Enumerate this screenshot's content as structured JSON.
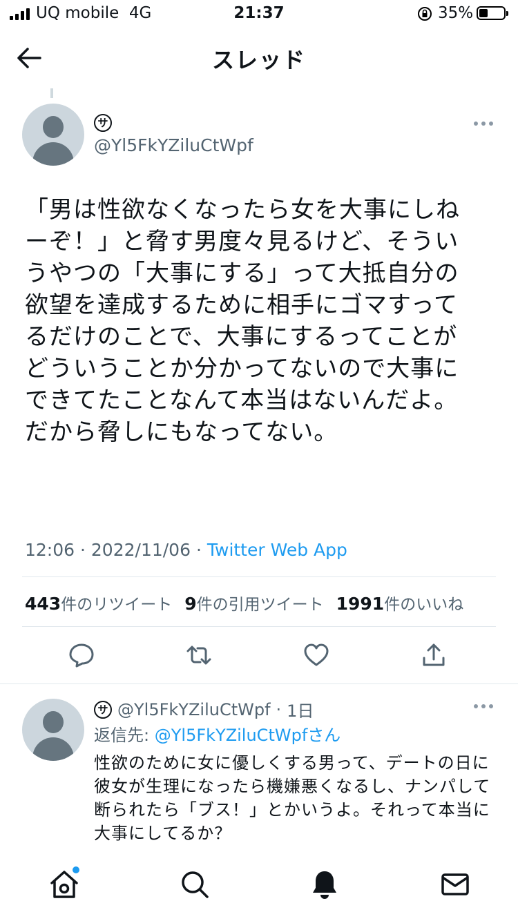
{
  "status_bar": {
    "carrier": "UQ mobile",
    "network": "4G",
    "time": "21:37",
    "battery_percent": "35%",
    "battery_level": 0.35
  },
  "header": {
    "title": "スレッド",
    "back_icon": "back-arrow-icon"
  },
  "tweet": {
    "display_name": "ⓢ",
    "handle": "@Yl5FkYZiluCtWpf",
    "text_lines": [
      "「男は性欲なくなったら女を大事にしね",
      "ーぞ！」と脅す男度々見るけど、そうい",
      "うやつの「大事にする」って大抵自分の",
      "欲望を達成するために相手にゴマすって",
      "るだけのことで、大事にするってことが",
      "どういうことか分かってないので大事に",
      "できてたことなんて本当はないんだよ。",
      "だから脅しにもなってない。"
    ],
    "time": "12:06",
    "date": "2022/11/06",
    "separator": "·",
    "source": "Twitter Web App",
    "stats": {
      "retweets_count": "443",
      "retweets_label": "件のリツイート",
      "quotes_count": "9",
      "quotes_label": "件の引用ツイート",
      "likes_count": "1991",
      "likes_label": "件のいいね"
    }
  },
  "reply": {
    "display_name": "ⓢ",
    "handle": "@Yl5FkYZiluCtWpf",
    "age": "1日",
    "reply_to_label": "返信先:",
    "reply_to_handle": "@Yl5FkYZiluCtWpf",
    "reply_to_suffix": "さん",
    "text_lines": [
      "性欲のために女に優しくする男って、デートの日に",
      "彼女が生理になったら機嫌悪くなるし、ナンパして",
      "断られたら「ブス！」とかいうよ。それって本当に",
      "大事にしてるか？"
    ]
  },
  "tab_bar": {
    "items": [
      "home-icon",
      "search-icon",
      "notifications-icon",
      "messages-icon"
    ]
  },
  "colors": {
    "accent": "#1d9bf0",
    "text": "#0f1419",
    "secondary": "#536471"
  }
}
